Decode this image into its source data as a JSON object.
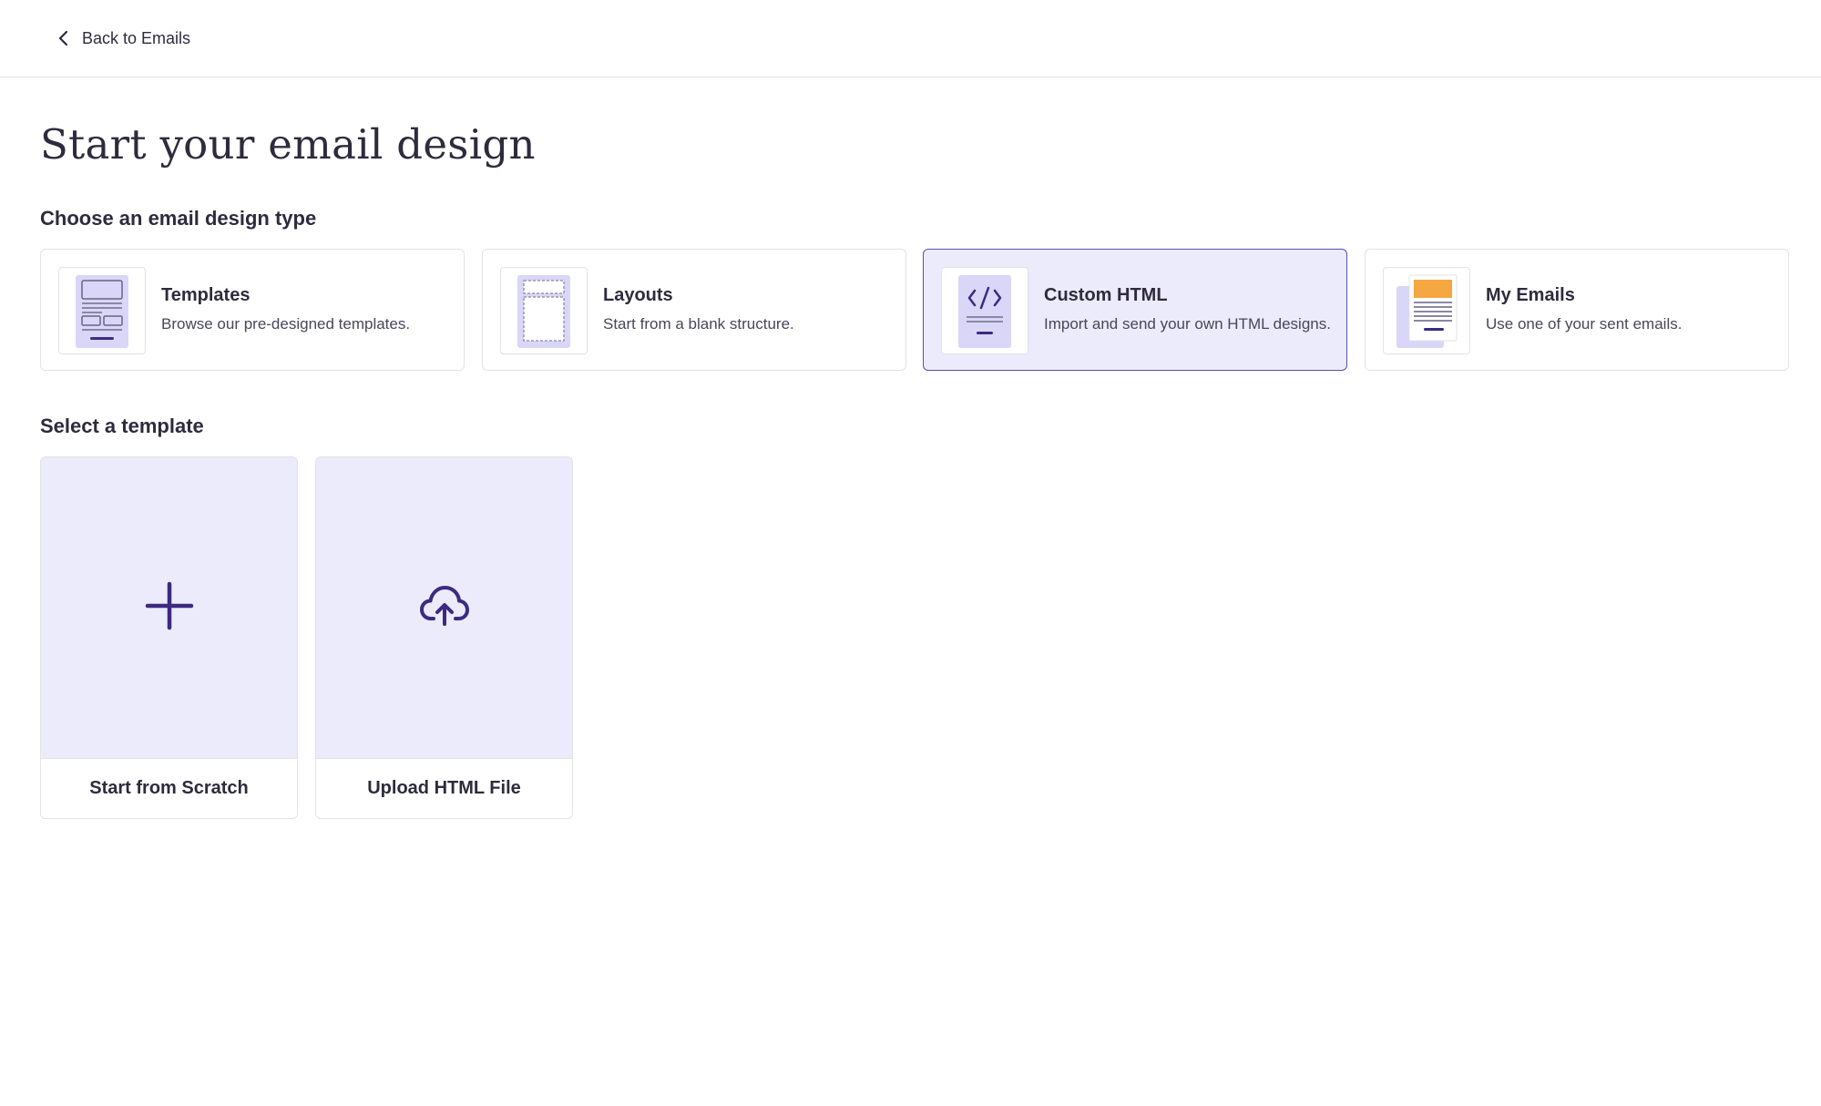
{
  "header": {
    "back_label": "Back to Emails",
    "back_icon": "chevron-left-icon"
  },
  "page": {
    "title": "Start your email design"
  },
  "design_types": {
    "heading": "Choose an email design type",
    "selected": "Custom HTML",
    "items": [
      {
        "title": "Templates",
        "description": "Browse our pre-designed templates.",
        "icon": "templates-thumbnail-icon"
      },
      {
        "title": "Layouts",
        "description": "Start from a blank structure.",
        "icon": "layouts-thumbnail-icon"
      },
      {
        "title": "Custom HTML",
        "description": "Import and send your own HTML designs.",
        "icon": "code-thumbnail-icon"
      },
      {
        "title": "My Emails",
        "description": "Use one of your sent emails.",
        "icon": "my-emails-thumbnail-icon"
      }
    ]
  },
  "templates": {
    "heading": "Select a template",
    "items": [
      {
        "label": "Start from Scratch",
        "icon": "plus-icon"
      },
      {
        "label": "Upload HTML File",
        "icon": "cloud-upload-icon"
      }
    ]
  },
  "colors": {
    "accent": "#3d2a80",
    "selected_bg": "#ebebfc",
    "selected_border": "#5b4fa8",
    "thumb_lavender": "#d9d6f7",
    "orange": "#f5a742",
    "text": "#2f2b3d"
  }
}
